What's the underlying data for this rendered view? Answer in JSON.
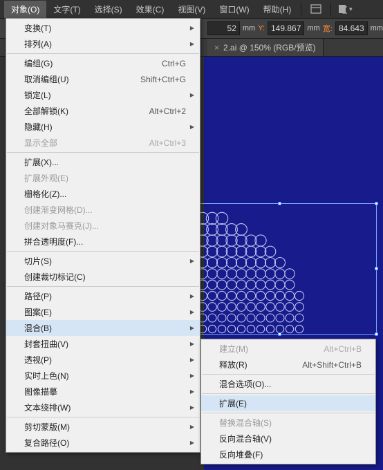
{
  "menubar": {
    "items": [
      "对象(O)",
      "文字(T)",
      "选择(S)",
      "效果(C)",
      "视图(V)",
      "窗口(W)",
      "帮助(H)"
    ]
  },
  "toolbar": {
    "v1": "52",
    "u1": "mm",
    "y": "Y:",
    "v2": "149.867",
    "u2": "mm",
    "w": "宽:",
    "v3": "84.643",
    "u3": "mm"
  },
  "tab": {
    "title": "2.ai @ 150% (RGB/预览)",
    "close": "×"
  },
  "menu": {
    "g1": [
      {
        "l": "变换(T)",
        "sub": true
      },
      {
        "l": "排列(A)",
        "sub": true
      }
    ],
    "g2": [
      {
        "l": "编组(G)",
        "sc": "Ctrl+G"
      },
      {
        "l": "取消编组(U)",
        "sc": "Shift+Ctrl+G"
      },
      {
        "l": "锁定(L)",
        "sub": true
      },
      {
        "l": "全部解锁(K)",
        "sc": "Alt+Ctrl+2"
      },
      {
        "l": "隐藏(H)",
        "sub": true
      },
      {
        "l": "显示全部",
        "sc": "Alt+Ctrl+3",
        "dis": true
      }
    ],
    "g3": [
      {
        "l": "扩展(X)..."
      },
      {
        "l": "扩展外观(E)",
        "dis": true
      },
      {
        "l": "栅格化(Z)..."
      },
      {
        "l": "创建渐变网格(D)...",
        "dis": true
      },
      {
        "l": "创建对象马赛克(J)...",
        "dis": true
      },
      {
        "l": "拼合透明度(F)..."
      }
    ],
    "g4": [
      {
        "l": "切片(S)",
        "sub": true
      },
      {
        "l": "创建裁切标记(C)"
      }
    ],
    "g5": [
      {
        "l": "路径(P)",
        "sub": true
      },
      {
        "l": "图案(E)",
        "sub": true
      },
      {
        "l": "混合(B)",
        "sub": true,
        "hl": true
      },
      {
        "l": "封套扭曲(V)",
        "sub": true
      },
      {
        "l": "透视(P)",
        "sub": true
      },
      {
        "l": "实时上色(N)",
        "sub": true
      },
      {
        "l": "图像描摹",
        "sub": true
      },
      {
        "l": "文本绕排(W)",
        "sub": true
      }
    ],
    "g6": [
      {
        "l": "剪切蒙版(M)",
        "sub": true
      },
      {
        "l": "复合路径(O)",
        "sub": true
      }
    ]
  },
  "submenu": {
    "g1": [
      {
        "l": "建立(M)",
        "sc": "Alt+Ctrl+B",
        "dis": true
      },
      {
        "l": "释放(R)",
        "sc": "Alt+Shift+Ctrl+B"
      }
    ],
    "g2": [
      {
        "l": "混合选项(O)..."
      }
    ],
    "g3": [
      {
        "l": "扩展(E)",
        "hl": true
      }
    ],
    "g4": [
      {
        "l": "替换混合轴(S)",
        "dis": true
      },
      {
        "l": "反向混合轴(V)"
      },
      {
        "l": "反向堆叠(F)"
      }
    ]
  }
}
